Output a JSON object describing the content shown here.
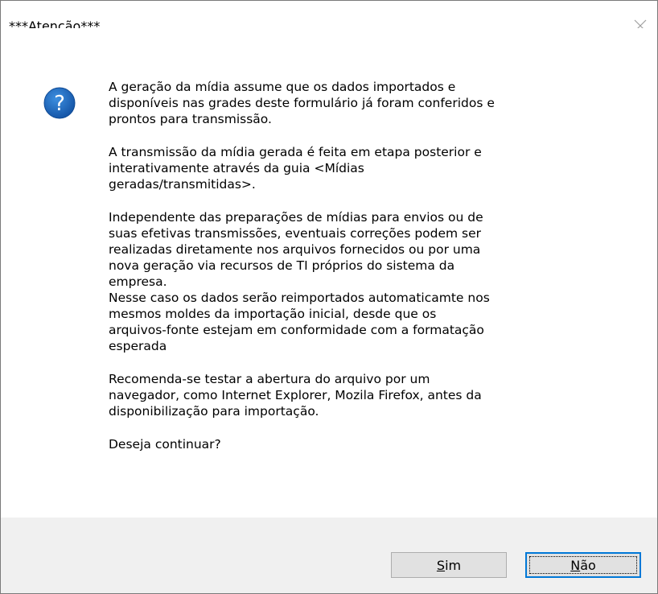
{
  "window": {
    "title": "***Atenção***",
    "close_icon": "close-icon"
  },
  "icon": "question-icon",
  "message": {
    "p1_l1": "A geração da mídia assume que os dados importados e",
    "p1_l2": "disponíveis nas grades deste formulário já foram conferidos e",
    "p1_l3": "prontos para transmissão.",
    "p2_l1": "A transmissão da mídia gerada é feita em etapa posterior e",
    "p2_l2": "interativamente através da guia <Mídias",
    "p2_l3": "geradas/transmitidas>.",
    "p3_l1": "Independente das preparações de mídias para envios ou de",
    "p3_l2": "suas efetivas transmissões, eventuais correções podem ser",
    "p3_l3": "realizadas diretamente nos arquivos fornecidos ou por uma",
    "p3_l4": "nova geração via recursos de TI próprios do sistema da",
    "p3_l5": "empresa.",
    "p4_l1": "Nesse caso os dados serão reimportados automaticamte nos",
    "p4_l2": "mesmos moldes da importação inicial, desde que os",
    "p4_l3": "arquivos-fonte estejam em conformidade com a formatação",
    "p4_l4": "esperada",
    "p5_l1": "Recomenda-se testar a abertura do arquivo por um",
    "p5_l2": "navegador, como Internet Explorer, Mozila Firefox, antes da",
    "p5_l3": "disponibilização para importação.",
    "p6_l1": "Deseja continuar?"
  },
  "buttons": {
    "yes_mnemonic": "S",
    "yes_rest": "im",
    "no_mnemonic": "N",
    "no_rest": "ão"
  },
  "colors": {
    "focus_border": "#0078d7",
    "icon_blue": "#1c64b4",
    "footer_bg": "#f0f0f0"
  }
}
